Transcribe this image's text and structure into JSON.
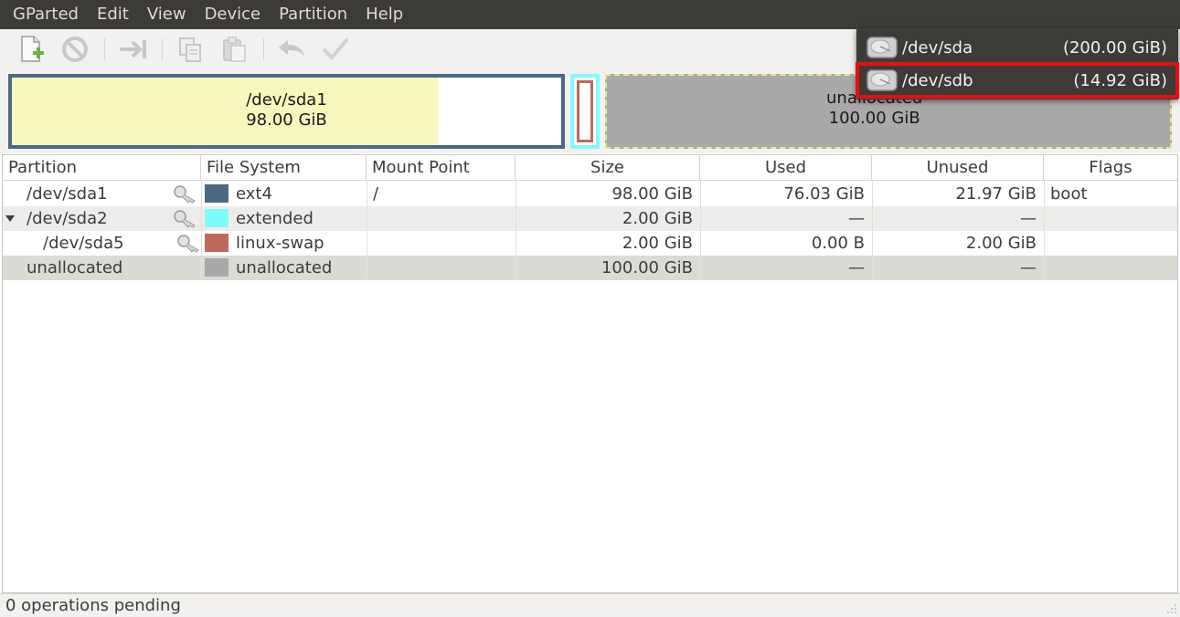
{
  "menubar": {
    "items": [
      "GParted",
      "Edit",
      "View",
      "Device",
      "Partition",
      "Help"
    ]
  },
  "toolbar": {
    "buttons": [
      "new-icon",
      "delete-icon",
      "resize-move-icon",
      "copy-icon",
      "paste-icon",
      "undo-icon",
      "apply-icon"
    ]
  },
  "graph": {
    "sda1": {
      "name": "/dev/sda1",
      "size": "98.00 GiB",
      "used_fraction": 0.776
    },
    "unallocated": {
      "name": "unallocated",
      "size": "100.00 GiB"
    },
    "colors": {
      "ext4": "#4b6983",
      "used": "#f7f6bd",
      "extended": "#7dfcfe",
      "swap": "#c1665a",
      "unallocated": "#a9a9a9"
    }
  },
  "devices": [
    {
      "path": "/dev/sda",
      "size": "(200.00 GiB)"
    },
    {
      "path": "/dev/sdb",
      "size": "(14.92 GiB)"
    }
  ],
  "table": {
    "headers": [
      "Partition",
      "File System",
      "Mount Point",
      "Size",
      "Used",
      "Unused",
      "Flags"
    ],
    "rows": [
      {
        "partition": "/dev/sda1",
        "fs": "ext4",
        "fs_color": "#4b6983",
        "mount": "/",
        "size": "98.00 GiB",
        "used": "76.03 GiB",
        "unused": "21.97 GiB",
        "flags": "boot"
      },
      {
        "partition": "/dev/sda2",
        "fs": "extended",
        "fs_color": "#7dfcfe",
        "mount": "",
        "size": "2.00 GiB",
        "used": "—",
        "unused": "—",
        "flags": ""
      },
      {
        "partition": "/dev/sda5",
        "fs": "linux-swap",
        "fs_color": "#c1665a",
        "mount": "",
        "size": "2.00 GiB",
        "used": "0.00 B",
        "unused": "2.00 GiB",
        "flags": ""
      },
      {
        "partition": "unallocated",
        "fs": "unallocated",
        "fs_color": "#a9a9a9",
        "mount": "",
        "size": "100.00 GiB",
        "used": "—",
        "unused": "—",
        "flags": ""
      }
    ]
  },
  "status": {
    "text": "0 operations pending"
  }
}
